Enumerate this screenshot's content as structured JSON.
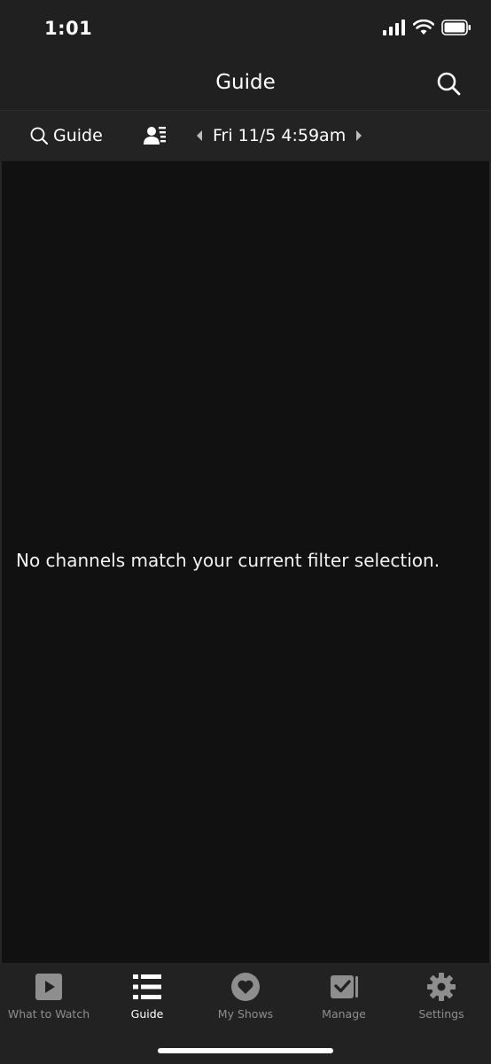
{
  "status_bar": {
    "time": "1:01"
  },
  "header": {
    "title": "Guide"
  },
  "filter_bar": {
    "guide_label": "Guide",
    "date_label": "Fri 11/5 4:59am"
  },
  "main": {
    "empty_message": "No channels match your current filter selection."
  },
  "tab_bar": {
    "active": "Guide",
    "tabs": [
      {
        "label": "What to Watch",
        "icon": "play-icon"
      },
      {
        "label": "Guide",
        "icon": "list-icon"
      },
      {
        "label": "My Shows",
        "icon": "heart-icon"
      },
      {
        "label": "Manage",
        "icon": "checkbox-icon"
      },
      {
        "label": "Settings",
        "icon": "gear-icon"
      }
    ]
  },
  "colors": {
    "background": "#111111",
    "bar": "#202020",
    "active_tab": "#ffffff",
    "inactive_tab": "#8e8e8e"
  }
}
